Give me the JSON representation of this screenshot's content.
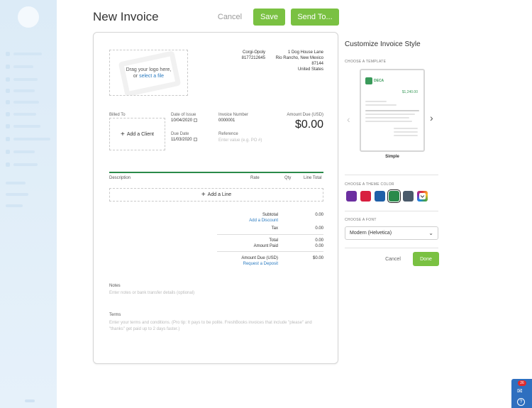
{
  "header": {
    "title": "New Invoice",
    "cancel_label": "Cancel",
    "save_label": "Save",
    "send_label": "Send To..."
  },
  "invoice": {
    "logo": {
      "line1": "Drag your logo here,",
      "line2_prefix": "or ",
      "line2_link": "select a file"
    },
    "company": {
      "name": "Corgi-Opoly",
      "phone": "8177212645"
    },
    "address": {
      "line1": "1 Dog House Lane",
      "line2": "Rio Rancho, New Mexico",
      "line3": "87144",
      "line4": "United States"
    },
    "billed_to_label": "Billed To",
    "add_client_label": "Add a Client",
    "date_of_issue_label": "Date of Issue",
    "date_of_issue": "10/04/2020",
    "due_date_label": "Due Date",
    "due_date": "11/03/2020",
    "invoice_number_label": "Invoice Number",
    "invoice_number": "0000001",
    "reference_label": "Reference",
    "reference_placeholder": "Enter value (e.g. PO #)",
    "amount_due_label": "Amount Due (USD)",
    "amount_due": "$0.00",
    "columns": {
      "description": "Description",
      "rate": "Rate",
      "qty": "Qty",
      "line_total": "Line Total"
    },
    "add_line_label": "Add a Line",
    "totals": {
      "subtotal_label": "Subtotal",
      "subtotal": "0.00",
      "add_discount_label": "Add a Discount",
      "tax_label": "Tax",
      "tax": "0.00",
      "total_label": "Total",
      "total": "0.00",
      "amount_paid_label": "Amount Paid",
      "amount_paid": "0.00",
      "amount_due_label": "Amount Due (USD)",
      "amount_due": "$0.00",
      "request_deposit_label": "Request a Deposit"
    },
    "notes_label": "Notes",
    "notes_placeholder": "Enter notes or bank transfer details (optional)",
    "terms_label": "Terms",
    "terms_placeholder": "Enter your terms and conditions. (Pro tip: It pays to be polite. FreshBooks invoices that include \"please\" and \"thanks\" get paid up to 2 days faster.)"
  },
  "customize": {
    "title": "Customize Invoice Style",
    "choose_template_label": "CHOOSE A TEMPLATE",
    "template_brand": "DECA",
    "template_amount": "$1,240.00",
    "template_name": "Simple",
    "choose_color_label": "CHOOSE A THEME COLOR",
    "colors": [
      "#6b2fa0",
      "#d81f3f",
      "#1f5fa8",
      "#2a8a4a",
      "#4a5a6a"
    ],
    "selected_color": "#2a8a4a",
    "choose_font_label": "CHOOSE A FONT",
    "font_value": "Modern (Helvetica)",
    "cancel_label": "Cancel",
    "done_label": "Done"
  },
  "help": {
    "badge": "26"
  }
}
